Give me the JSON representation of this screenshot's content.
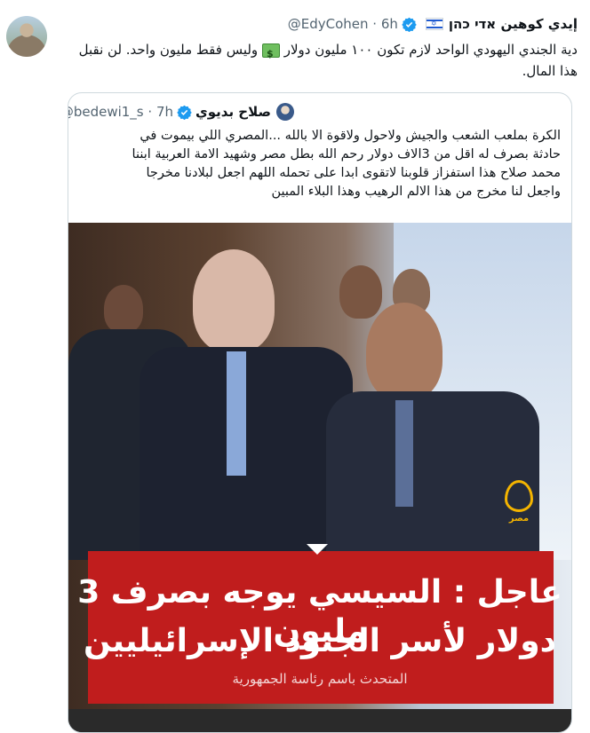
{
  "tweet": {
    "author_name": "إيدي كوهين אדי כהן",
    "handle": "@EdyCohen",
    "time": "6h",
    "text_part1": "دية الجندي اليهودي الواحد لازم تكون ١٠٠ مليون دولار",
    "text_part2": "وليس فقط مليون واحد. لن نقبل هذا المال.",
    "icons": {
      "verified": "verified-badge-icon",
      "flag": "israel-flag-icon",
      "money": "money-emoji-icon"
    }
  },
  "quote": {
    "author_name": "صلاح بديوي",
    "handle": "@bedewi1_s",
    "time": "7h",
    "lines": [
      "الكرة بملعب الشعب والجيش ولاحول ولاقوة الا بالله ...المصري اللي بيموت في",
      "حادثة بصرف له اقل من 3الاف دولار   رحم الله بطل مصر  وشهيد الامة العربية ابننا",
      "محمد صلاح هذا استفزاز قلوبنا لاتقوى ابدا على تحمله اللهم اجعل لبلادنا مخرجا",
      "واجعل لنا مخرج من هذا الالم الرهيب وهذا البلاء المبين"
    ]
  },
  "media": {
    "headline_line1": "عاجل : السيسي يوجه بصرف 3 مليون",
    "headline_line2": "دولار لأسر الجنود الإسرائيليين",
    "subline": "المتحدث باسم رئاسة الجمهورية",
    "logo_text": "مصر"
  },
  "colors": {
    "banner": "#c01d1d",
    "verified": "#1d9bf0",
    "logo": "#f4b400"
  }
}
